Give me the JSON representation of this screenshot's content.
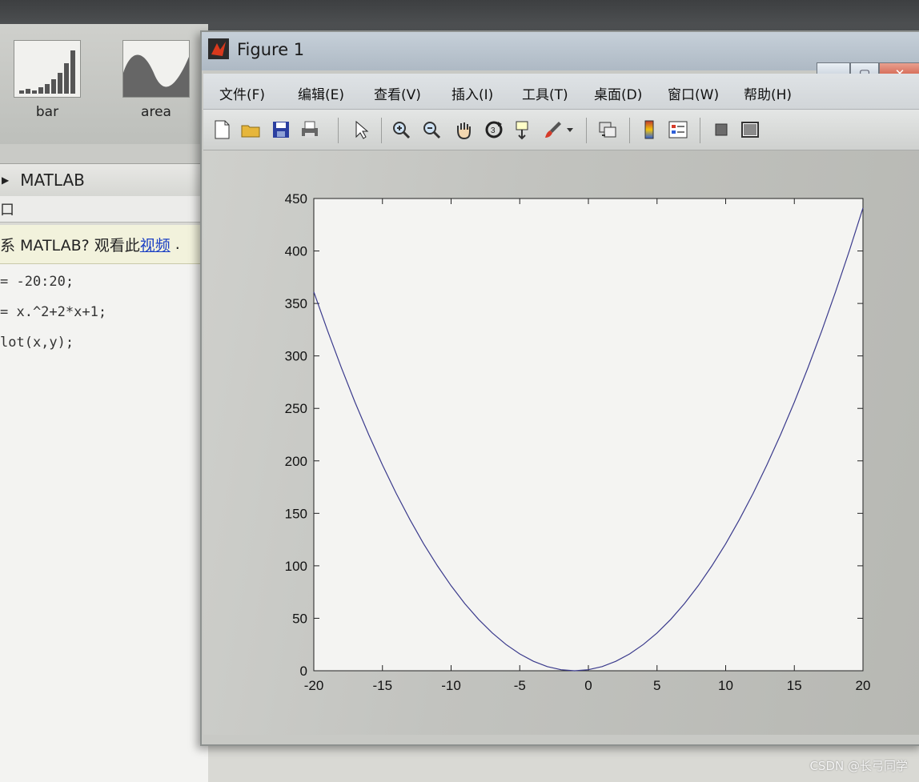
{
  "background": {
    "gallery": [
      {
        "label": "bar",
        "icon": "bar-chart-thumbnail-icon"
      },
      {
        "label": "area",
        "icon": "area-chart-thumbnail-icon"
      }
    ],
    "matlab_tab": "MATLAB",
    "command_window_title": "口",
    "help_bar": {
      "prefix": "系 MATLAB? 观看此",
      "link": "视频",
      "suffix": "."
    },
    "code_lines": [
      "= -20:20;",
      "= x.^2+2*x+1;",
      "lot(x,y);"
    ]
  },
  "figure": {
    "title": "Figure 1",
    "menus": [
      "文件(F)",
      "编辑(E)",
      "查看(V)",
      "插入(I)",
      "工具(T)",
      "桌面(D)",
      "窗口(W)",
      "帮助(H)"
    ],
    "toolbar": [
      "new-figure-icon",
      "open-file-icon",
      "save-icon",
      "print-icon",
      "edit-plot-arrow-icon",
      "zoom-in-icon",
      "zoom-out-icon",
      "pan-hand-icon",
      "rotate-3d-icon",
      "data-cursor-icon",
      "brush-icon",
      "brush-dropdown-icon",
      "link-plot-icon",
      "insert-colorbar-icon",
      "insert-legend-icon",
      "hide-plot-tools-icon",
      "show-plot-tools-icon"
    ],
    "colors": {
      "line": "#3a3a8c",
      "axes_bg": "#f4f4f2"
    }
  },
  "chart_data": {
    "type": "line",
    "title": "",
    "xlabel": "",
    "ylabel": "",
    "xlim": [
      -20,
      20
    ],
    "ylim": [
      0,
      450
    ],
    "xticks": [
      -20,
      -15,
      -10,
      -5,
      0,
      5,
      10,
      15,
      20
    ],
    "yticks": [
      0,
      50,
      100,
      150,
      200,
      250,
      300,
      350,
      400,
      450
    ],
    "grid": false,
    "series": [
      {
        "x": [
          -20,
          -19,
          -18,
          -17,
          -16,
          -15,
          -14,
          -13,
          -12,
          -11,
          -10,
          -9,
          -8,
          -7,
          -6,
          -5,
          -4,
          -3,
          -2,
          -1,
          0,
          1,
          2,
          3,
          4,
          5,
          6,
          7,
          8,
          9,
          10,
          11,
          12,
          13,
          14,
          15,
          16,
          17,
          18,
          19,
          20
        ],
        "values": [
          361,
          324,
          289,
          256,
          225,
          196,
          169,
          144,
          121,
          100,
          81,
          64,
          49,
          36,
          25,
          16,
          9,
          4,
          1,
          0,
          1,
          4,
          9,
          16,
          25,
          36,
          49,
          64,
          81,
          100,
          121,
          144,
          169,
          196,
          225,
          256,
          289,
          324,
          361,
          400,
          441
        ]
      }
    ]
  },
  "watermark": "CSDN @长弓同学"
}
